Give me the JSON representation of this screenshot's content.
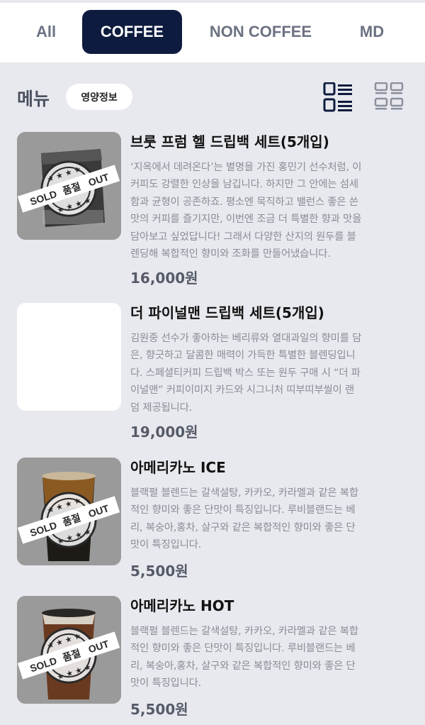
{
  "tabs": [
    {
      "label": "All"
    },
    {
      "label": "COFFEE"
    },
    {
      "label": "NON COFFEE"
    },
    {
      "label": "MD"
    }
  ],
  "menu": {
    "title": "메뉴",
    "nutrition_label": "영양정보"
  },
  "stamp": {
    "left": "SOLD",
    "mid": "품절",
    "right": "OUT"
  },
  "items": [
    {
      "name": "브룻 프럼 헬 드립백 세트(5개입)",
      "lines": [
        "‘지옥에서 데려온다’는 별명을 가진 홍민기 선수처럼, 이",
        "커피도 강렬한 인상을 남깁니다. 하지만 그 안에는 섬세",
        "함과 균형이 공존하죠. 평소엔 묵직하고 밸런스 좋은 쓴",
        "맛의 커피를 즐기지만, 이번엔 조금 더 특별한 향과 맛을",
        "담아보고 싶었답니다! 그래서 다양한 산지의 원두를 블",
        "렌딩해 복합적인 향미와 조화를 만들어냈습니다."
      ],
      "price": "16,000원",
      "sold_out": true
    },
    {
      "name": "더 파이널맨 드립백 세트(5개입)",
      "lines": [
        "김원중 선수가 좋아하는 베리류와 열대과일의 향미를 담",
        "은, 향긋하고 달콤한 매력이 가득한 특별한 블렌딩입니",
        "다. 스페셜티커피 드립백 박스 또는 원두 구매 시 “더 파",
        "이널맨” 커피이미지 카드와 시그니처 띠부띠부씰이 랜",
        "덤 제공됩니다."
      ],
      "price": "19,000원",
      "sold_out": false
    },
    {
      "name": "아메리카노 ICE",
      "lines": [
        "블랙펄 블렌드는 갈색설탕, 카카오, 카라멜과 같은 복합",
        "적인 향미와 좋은 단맛이 특징입니다. 루비블랜드는 베",
        "리, 복숭아,홍차, 살구와 같은 복합적인 향미와 좋은 단",
        "맛이 특징입니다."
      ],
      "price": "5,500원",
      "sold_out": true
    },
    {
      "name": "아메리카노 HOT",
      "lines": [
        "블랙펄 블렌드는 갈색설탕, 카카오, 카라멜과 같은 복합",
        "적인 향미와 좋은 단맛이 특징입니다. 루비블랜드는 베",
        "리, 복숭아,홍차, 살구와 같은 복합적인 향미와 좋은 단",
        "맛이 특징입니다."
      ],
      "price": "5,500원",
      "sold_out": true
    }
  ]
}
